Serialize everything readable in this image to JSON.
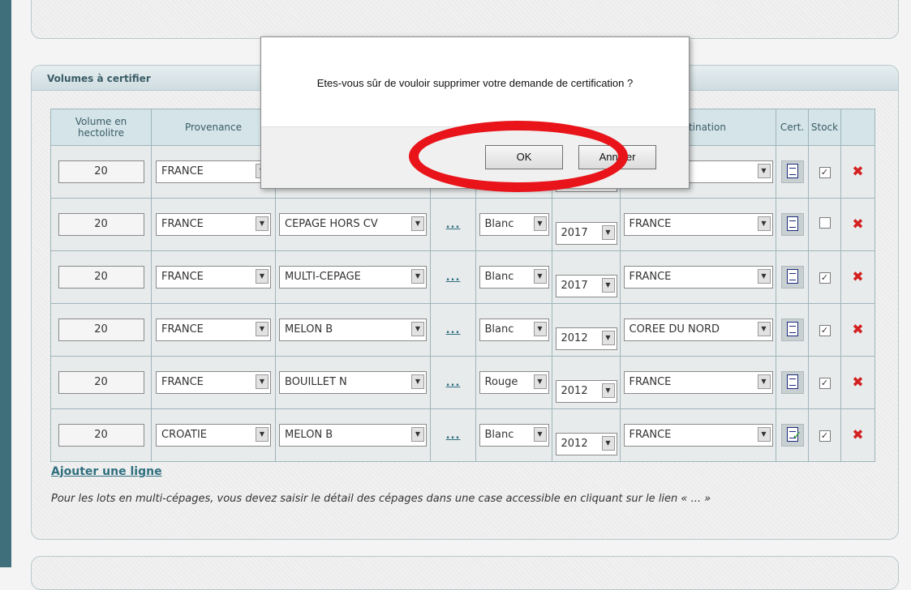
{
  "panel_title": "Volumes à certifier",
  "table": {
    "headers": {
      "volume": "Volume en hectolitre",
      "provenance": "Provenance",
      "destination": "Destination",
      "cert": "Cert.",
      "stock": "Stock"
    },
    "rows": [
      {
        "volume": "20",
        "provenance": "FRANCE",
        "cepage": "",
        "details": "...",
        "couleur": "",
        "millesime": "",
        "destination": "",
        "cert_icon": "document-icon",
        "stock_checked": true
      },
      {
        "volume": "20",
        "provenance": "FRANCE",
        "cepage": "CEPAGE HORS CV",
        "details": "...",
        "couleur": "Blanc",
        "millesime": "2017",
        "destination": "FRANCE",
        "cert_icon": "document-icon",
        "stock_checked": false
      },
      {
        "volume": "20",
        "provenance": "FRANCE",
        "cepage": "MULTI-CEPAGE",
        "details": "...",
        "couleur": "Blanc",
        "millesime": "2017",
        "destination": "FRANCE",
        "cert_icon": "document-icon",
        "stock_checked": true
      },
      {
        "volume": "20",
        "provenance": "FRANCE",
        "cepage": "MELON B",
        "details": "...",
        "couleur": "Blanc",
        "millesime": "2012",
        "destination": "COREE DU NORD",
        "cert_icon": "document-icon",
        "stock_checked": true
      },
      {
        "volume": "20",
        "provenance": "FRANCE",
        "cepage": "BOUILLET N",
        "details": "...",
        "couleur": "Rouge",
        "millesime": "2012",
        "destination": "FRANCE",
        "cert_icon": "document-icon",
        "stock_checked": true
      },
      {
        "volume": "20",
        "provenance": "CROATIE",
        "cepage": "MELON B",
        "details": "...",
        "couleur": "Blanc",
        "millesime": "2012",
        "destination": "FRANCE",
        "cert_icon": "document-edit-icon",
        "stock_checked": true
      }
    ]
  },
  "add_line_label": "Ajouter une ligne",
  "help_text": "Pour les lots en multi-cépages, vous devez saisir le détail des cépages dans une case accessible en cliquant sur le lien « ... »",
  "dialog": {
    "message": "Etes-vous sûr de vouloir supprimer votre demande de certification ?",
    "ok_label": "OK",
    "cancel_label": "Annuler"
  },
  "colors": {
    "accent": "#2f6f7f",
    "header_bg": "#d4e4e8",
    "highlight": "#e8141a",
    "delete": "#d42020"
  }
}
